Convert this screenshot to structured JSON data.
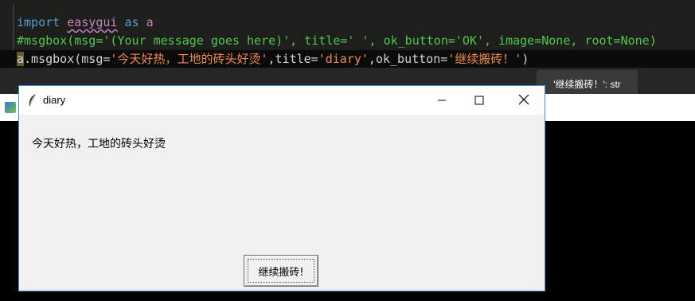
{
  "editor": {
    "line1": {
      "import_kw": "import",
      "module": "easygui",
      "as_kw": "as",
      "alias": "a"
    },
    "line2": {
      "comment": "#msgbox(msg='(Your message goes here)', title=' ', ok_button='OK', image=None, root=None)"
    },
    "line3": {
      "obj": "a",
      "call_open": ".msgbox(msg=",
      "msg_str": "'今天好热，工地的砖头好烫'",
      "mid1": ",title=",
      "title_str": "'diary'",
      "mid2": ",ok_button=",
      "btn_str": "'继续搬砖！'",
      "call_close": ")"
    }
  },
  "tooltip": {
    "text": "'继续搬砖！': str"
  },
  "dialog": {
    "title": "diary",
    "message": "今天好热，工地的砖头好烫",
    "ok_label": "继续搬砖!"
  },
  "colors": {
    "editor_bg": "#1e1f1c",
    "dialog_border": "#3c8fdc",
    "dialog_bg": "#f0f0f0"
  },
  "icons": {
    "window": "feather-icon",
    "minimize": "minimize-icon",
    "maximize": "maximize-icon",
    "close": "close-icon"
  }
}
